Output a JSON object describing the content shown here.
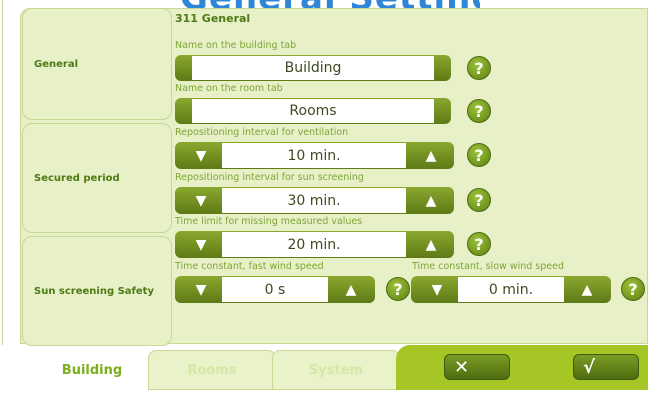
{
  "header": {
    "title": "General Settings"
  },
  "sidebar": {
    "items": [
      {
        "label": "General"
      },
      {
        "label": "Secured period"
      },
      {
        "label": "Sun screening Safety"
      }
    ]
  },
  "section": {
    "title": "311 General"
  },
  "fields": {
    "building_tab_name": {
      "label": "Name on the building tab",
      "value": "Building"
    },
    "room_tab_name": {
      "label": "Name on the room tab",
      "value": "Rooms"
    },
    "vent_interval": {
      "label": "Repositioning interval for ventilation",
      "value": "10 min."
    },
    "sun_interval": {
      "label": "Repositioning interval for sun screening",
      "value": "30 min."
    },
    "missing_values": {
      "label": "Time limit for missing measured values",
      "value": "20 min."
    },
    "fast_wind": {
      "label": "Time constant, fast wind speed",
      "value": "0 s"
    },
    "slow_wind": {
      "label": "Time constant, slow wind speed",
      "value": "0 min."
    }
  },
  "glyphs": {
    "down": "▼",
    "up": "▲",
    "help": "?",
    "cancel": "✕",
    "confirm": "√"
  },
  "tabs": [
    {
      "label": "Building",
      "active": true
    },
    {
      "label": "Rooms",
      "active": false
    },
    {
      "label": "System",
      "active": false
    }
  ],
  "colors": {
    "accent": "#a6c625",
    "panel": "#e7f0c6",
    "label": "#7fa63a",
    "title": "#2f86d6"
  }
}
